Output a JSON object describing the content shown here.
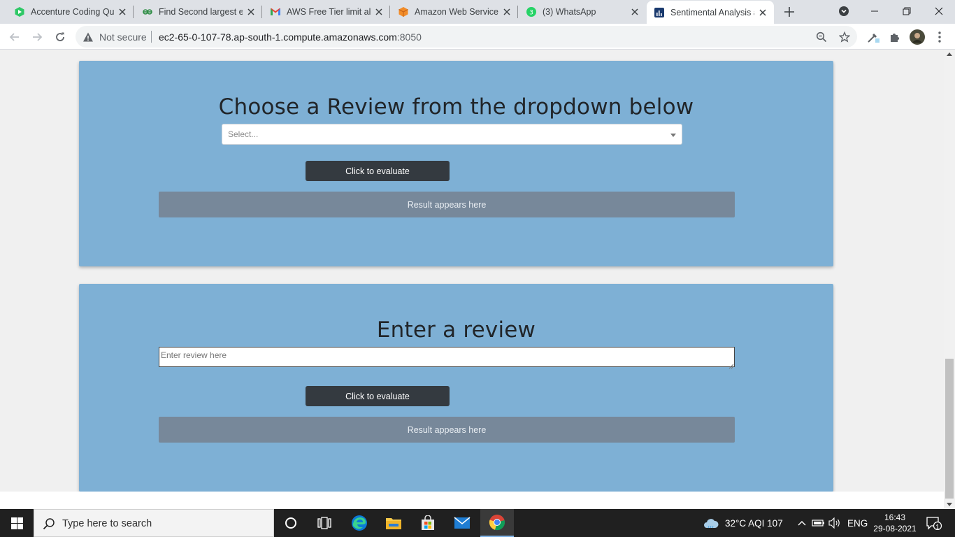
{
  "browser": {
    "tabs": [
      {
        "title": "Accenture Coding Que",
        "icon": "hackerearth-icon",
        "active": false
      },
      {
        "title": "Find Second largest el",
        "icon": "geeksforgeeks-icon",
        "active": false
      },
      {
        "title": "AWS Free Tier limit ale",
        "icon": "gmail-icon",
        "active": false
      },
      {
        "title": "Amazon Web Services",
        "icon": "aws-icon",
        "active": false
      },
      {
        "title": "(3) WhatsApp",
        "icon": "whatsapp-icon",
        "badge": "3",
        "active": false
      },
      {
        "title": "Sentimental Analysis a",
        "icon": "chart-icon",
        "active": true
      }
    ],
    "address": {
      "security_label": "Not secure",
      "host": "ec2-65-0-107-78.ap-south-1.compute.amazonaws.com",
      "port": ":8050"
    }
  },
  "page": {
    "section1": {
      "heading": "Choose a Review from the dropdown below",
      "dropdown_placeholder": "Select...",
      "button_label": "Click to evaluate",
      "result_text": "Result appears here"
    },
    "section2": {
      "heading": "Enter a review",
      "input_placeholder": "Enter review here",
      "button_label": "Click to evaluate",
      "result_text": "Result appears here"
    }
  },
  "taskbar": {
    "search_placeholder": "Type here to search",
    "weather": "32°C  AQI 107",
    "language": "ENG",
    "time": "16:43",
    "date": "29-08-2021",
    "notification_count": "1"
  },
  "colors": {
    "card_bg": "#7eb0d5",
    "button_bg": "#343a40",
    "result_bg": "#77889a",
    "page_bg": "#f0f0f0"
  }
}
